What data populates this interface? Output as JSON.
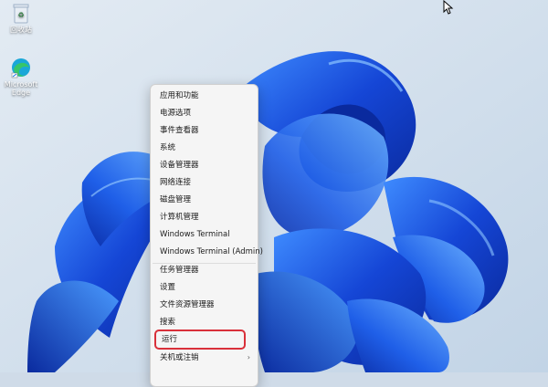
{
  "desktop": {
    "icons": [
      {
        "label": "回收站",
        "icon": "recycle-bin-icon"
      },
      {
        "label": "Microsoft Edge",
        "icon": "edge-icon"
      }
    ]
  },
  "context_menu": {
    "items": [
      {
        "label": "应用和功能"
      },
      {
        "label": "电源选项"
      },
      {
        "label": "事件查看器"
      },
      {
        "label": "系统"
      },
      {
        "label": "设备管理器"
      },
      {
        "label": "网络连接"
      },
      {
        "label": "磁盘管理"
      },
      {
        "label": "计算机管理"
      },
      {
        "label": "Windows Terminal"
      },
      {
        "label": "Windows Terminal (Admin)"
      },
      {
        "label": "任务管理器"
      },
      {
        "label": "设置"
      },
      {
        "label": "文件资源管理器"
      },
      {
        "label": "搜索"
      },
      {
        "label": "运行"
      },
      {
        "label": "关机或注销"
      }
    ],
    "highlighted": "运行",
    "highlight_color": "#d9303a"
  },
  "colors": {
    "wallpaper_bg": "#cfdbe8",
    "bloom_dark": "#0a2fb8",
    "bloom_mid": "#1f5fe8",
    "bloom_light": "#58a6ff"
  }
}
